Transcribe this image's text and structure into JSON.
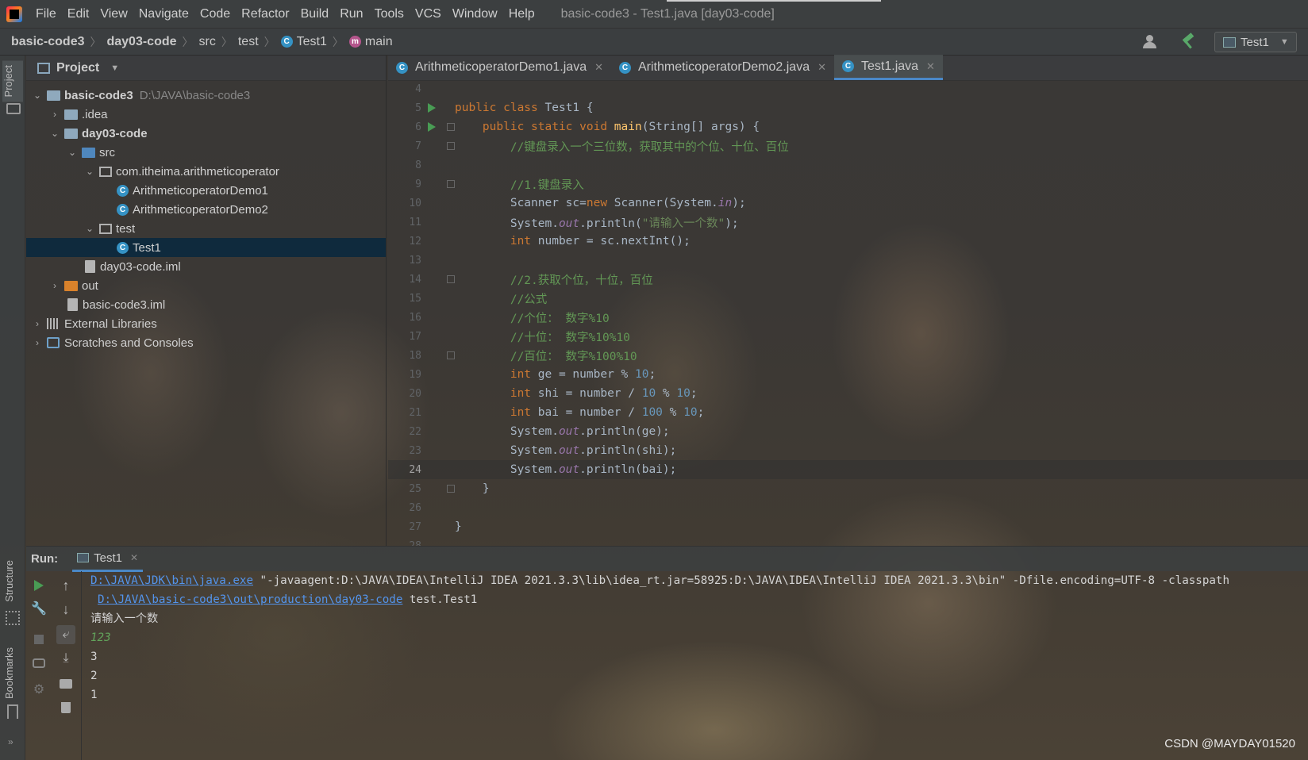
{
  "menubar": {
    "items": [
      "File",
      "Edit",
      "View",
      "Navigate",
      "Code",
      "Refactor",
      "Build",
      "Run",
      "Tools",
      "VCS",
      "Window",
      "Help"
    ],
    "window_title": "basic-code3 - Test1.java [day03-code]"
  },
  "navbar": {
    "crumbs": [
      "basic-code3",
      "day03-code",
      "src",
      "test",
      "Test1",
      "main"
    ],
    "run_config": "Test1"
  },
  "left_stripe": {
    "project": "Project",
    "structure": "Structure",
    "bookmarks": "Bookmarks"
  },
  "project_panel": {
    "title": "Project",
    "tree": [
      {
        "label": "basic-code3",
        "hint": "D:\\JAVA\\basic-code3"
      },
      {
        "label": ".idea"
      },
      {
        "label": "day03-code"
      },
      {
        "label": "src"
      },
      {
        "label": "com.itheima.arithmeticoperator"
      },
      {
        "label": "ArithmeticoperatorDemo1"
      },
      {
        "label": "ArithmeticoperatorDemo2"
      },
      {
        "label": "test"
      },
      {
        "label": "Test1"
      },
      {
        "label": "day03-code.iml"
      },
      {
        "label": "out"
      },
      {
        "label": "basic-code3.iml"
      },
      {
        "label": "External Libraries"
      },
      {
        "label": "Scratches and Consoles"
      }
    ]
  },
  "editor": {
    "tabs": [
      "ArithmeticoperatorDemo1.java",
      "ArithmeticoperatorDemo2.java",
      "Test1.java"
    ],
    "active_tab": "Test1.java",
    "line_numbers": [
      "4",
      "5",
      "6",
      "7",
      "8",
      "9",
      "10",
      "11",
      "12",
      "13",
      "14",
      "15",
      "16",
      "17",
      "18",
      "19",
      "20",
      "21",
      "22",
      "23",
      "24",
      "25",
      "26",
      "27",
      "28"
    ],
    "lines": {
      "l5": [
        "public class ",
        "Test1 {"
      ],
      "l6": [
        "public static void ",
        "main",
        "(String[] args) {"
      ],
      "l7": "//键盘录入一个三位数，获取其中的个位、十位、百位",
      "l9": "//1.键盘录入",
      "l10": [
        "Scanner sc=",
        "new ",
        "Scanner(System.",
        "in",
        ");"
      ],
      "l11": [
        "System.",
        "out",
        ".println(",
        "\"请输入一个数\"",
        ");"
      ],
      "l12": [
        "int ",
        "number = sc.nextInt();"
      ],
      "l14": "//2.获取个位，十位，百位",
      "l15": "//公式",
      "l16": "//个位： 数字%10",
      "l17": "//十位： 数字%10%10",
      "l18": "//百位： 数字%100%10",
      "l19": [
        "int ",
        "ge = number % ",
        "10",
        ";"
      ],
      "l20": [
        "int ",
        "shi = number / ",
        "10",
        " % ",
        "10",
        ";"
      ],
      "l21": [
        "int ",
        "bai = number / ",
        "100",
        " % ",
        "10",
        ";"
      ],
      "l22": [
        "System.",
        "out",
        ".println(ge);"
      ],
      "l23": [
        "System.",
        "out",
        ".println(shi);"
      ],
      "l24": [
        "System.",
        "out",
        ".println(bai);"
      ],
      "l25": "}",
      "l27": "}"
    }
  },
  "run_panel": {
    "title": "Run:",
    "tab": "Test1",
    "console": {
      "java_exe": "D:\\JAVA\\JDK\\bin\\java.exe",
      "args": " \"-javaagent:D:\\JAVA\\IDEA\\IntelliJ IDEA 2021.3.3\\lib\\idea_rt.jar=58925:D:\\JAVA\\IDEA\\IntelliJ IDEA 2021.3.3\\bin\" -Dfile.encoding=UTF-8 -classpath",
      "classpath_link": "D:\\JAVA\\basic-code3\\out\\production\\day03-code",
      "main_class": " test.Test1",
      "prompt": "请输入一个数",
      "input": "123",
      "out1": "3",
      "out2": "2",
      "out3": "1"
    }
  },
  "watermark": "CSDN @MAYDAY01520",
  "colors": {
    "keyword": "#cc7832",
    "comment": "#629755",
    "string": "#6a8759",
    "number": "#6897bb",
    "field": "#9876aa",
    "method": "#ffc66d",
    "link": "#5394ec",
    "selection": "#0d293e"
  }
}
